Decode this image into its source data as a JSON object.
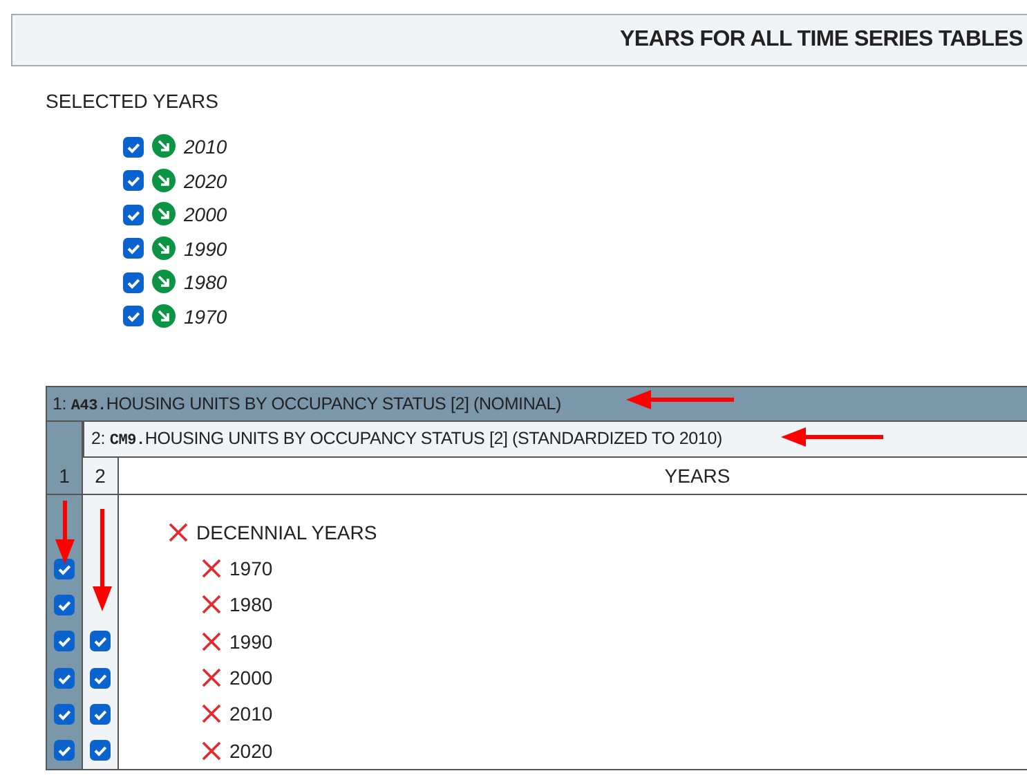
{
  "header": {
    "title": "YEARS FOR ALL TIME SERIES TABLES"
  },
  "selected_years": {
    "label": "SELECTED YEARS",
    "items": [
      {
        "year": "2010",
        "checked": true
      },
      {
        "year": "2020",
        "checked": true
      },
      {
        "year": "2000",
        "checked": true
      },
      {
        "year": "1990",
        "checked": true
      },
      {
        "year": "1980",
        "checked": true
      },
      {
        "year": "1970",
        "checked": true
      }
    ]
  },
  "tables": [
    {
      "number": "1:",
      "code": "A43.",
      "title": "HOUSING UNITS BY OCCUPANCY STATUS [2] (NOMINAL)"
    },
    {
      "number": "2:",
      "code": "CM9.",
      "title": "HOUSING UNITS BY OCCUPANCY STATUS [2] (STANDARDIZED TO 2010)"
    }
  ],
  "columns": [
    "1",
    "2",
    "YEARS"
  ],
  "group": {
    "label": "DECENNIAL YEARS",
    "rows": [
      {
        "year": "1970",
        "checkboxes": [
          {
            "checked": true
          }
        ]
      },
      {
        "year": "1980",
        "checkboxes": [
          {
            "checked": true
          }
        ]
      },
      {
        "year": "1990",
        "checkboxes": [
          {
            "checked": true
          },
          {
            "checked": true
          }
        ]
      },
      {
        "year": "2000",
        "checkboxes": [
          {
            "checked": true
          },
          {
            "checked": true
          }
        ]
      },
      {
        "year": "2010",
        "checkboxes": [
          {
            "checked": true
          },
          {
            "checked": true
          }
        ]
      },
      {
        "year": "2020",
        "checkboxes": [
          {
            "checked": true
          },
          {
            "checked": true
          }
        ]
      }
    ]
  }
}
